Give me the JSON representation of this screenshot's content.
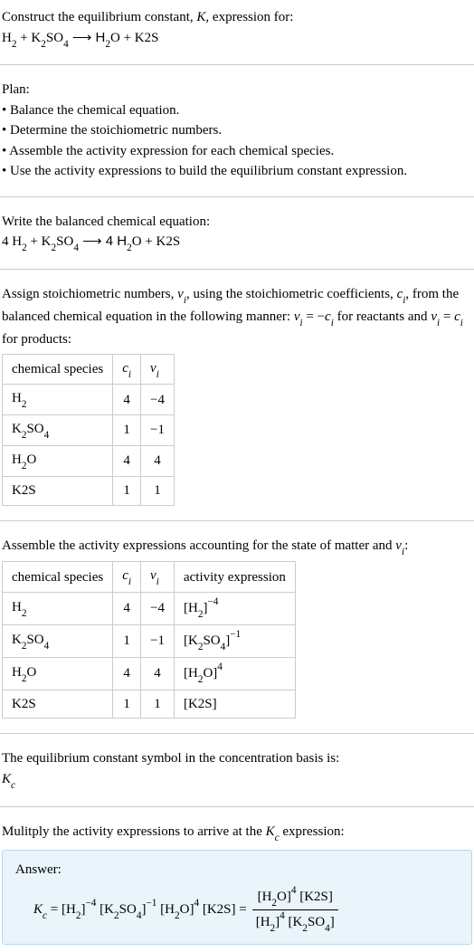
{
  "prompt_line1": "Construct the equilibrium constant, ",
  "prompt_K": "K",
  "prompt_line1b": ", expression for:",
  "equation1": {
    "r1": "H",
    "r1sub": "2",
    "plus1": " + K",
    "r2sub": "2",
    "r2": "SO",
    "r2sub2": "4",
    "arrow": "  ⟶  H",
    "p1sub": "2",
    "p1": "O + K2S"
  },
  "plan_heading": "Plan:",
  "plan1": "• Balance the chemical equation.",
  "plan2": "• Determine the stoichiometric numbers.",
  "plan3": "• Assemble the activity expression for each chemical species.",
  "plan4": "• Use the activity expressions to build the equilibrium constant expression.",
  "balanced_heading": "Write the balanced chemical equation:",
  "balanced": {
    "a": "4 H",
    "asub": "2",
    "b": " + K",
    "bsub": "2",
    "c": "SO",
    "csub": "4",
    "arrow": "  ⟶  4 H",
    "dsub": "2",
    "e": "O + K2S"
  },
  "assign_text1": "Assign stoichiometric numbers, ",
  "nu": "ν",
  "sub_i": "i",
  "assign_text2": ", using the stoichiometric coefficients, ",
  "c": "c",
  "assign_text3": ", from the balanced chemical equation in the following manner: ",
  "eq_nu": "ν",
  "eq_text1": " = −",
  "eq_c": "c",
  "assign_text4": " for reactants and ",
  "eq_text2": " = ",
  "assign_text5": " for products:",
  "table1": {
    "h1": "chemical species",
    "h2": "c",
    "h3": "ν",
    "r1c1a": "H",
    "r1c1s": "2",
    "r1c2": "4",
    "r1c3": "−4",
    "r2c1a": "K",
    "r2c1s": "2",
    "r2c1b": "SO",
    "r2c1s2": "4",
    "r2c2": "1",
    "r2c3": "−1",
    "r3c1a": "H",
    "r3c1s": "2",
    "r3c1b": "O",
    "r3c2": "4",
    "r3c3": "4",
    "r4c1": "K2S",
    "r4c2": "1",
    "r4c3": "1"
  },
  "assemble_text1": "Assemble the activity expressions accounting for the state of matter and ",
  "assemble_text2": ":",
  "table2": {
    "h1": "chemical species",
    "h2": "c",
    "h3": "ν",
    "h4": "activity expression",
    "r1e1": "[H",
    "r1e1s": "2",
    "r1e2": "]",
    "r1sup": "−4",
    "r2e1": "[K",
    "r2e1s": "2",
    "r2e2": "SO",
    "r2e2s": "4",
    "r2e3": "]",
    "r2sup": "−1",
    "r3e1": "[H",
    "r3e1s": "2",
    "r3e2": "O]",
    "r3sup": "4",
    "r4e1": "[K2S]"
  },
  "symbol_text": "The equilibrium constant symbol in the concentration basis is:",
  "Kc": "K",
  "Kc_sub": "c",
  "multiply_text1": "Mulitply the activity expressions to arrive at the ",
  "multiply_text2": " expression:",
  "answer_label": "Answer:",
  "final": {
    "lhs": "K",
    "lhs_sub": "c",
    "eq": " = [H",
    "t1s": "2",
    "t1e": "]",
    "t1sup": "−4",
    "sp1": " [K",
    "t2s": "2",
    "t2m": "SO",
    "t2s2": "4",
    "t2e": "]",
    "t2sup": "−1",
    "sp2": " [H",
    "t3s": "2",
    "t3e": "O]",
    "t3sup": "4",
    "sp3": " [K2S] = ",
    "num1": "[H",
    "num1s": "2",
    "num1e": "O]",
    "num1sup": "4",
    "numsp": " [K2S]",
    "den1": "[H",
    "den1s": "2",
    "den1e": "]",
    "den1sup": "4",
    "densp": " [K",
    "den2s": "2",
    "den2m": "SO",
    "den2s2": "4",
    "den2e": "]"
  }
}
